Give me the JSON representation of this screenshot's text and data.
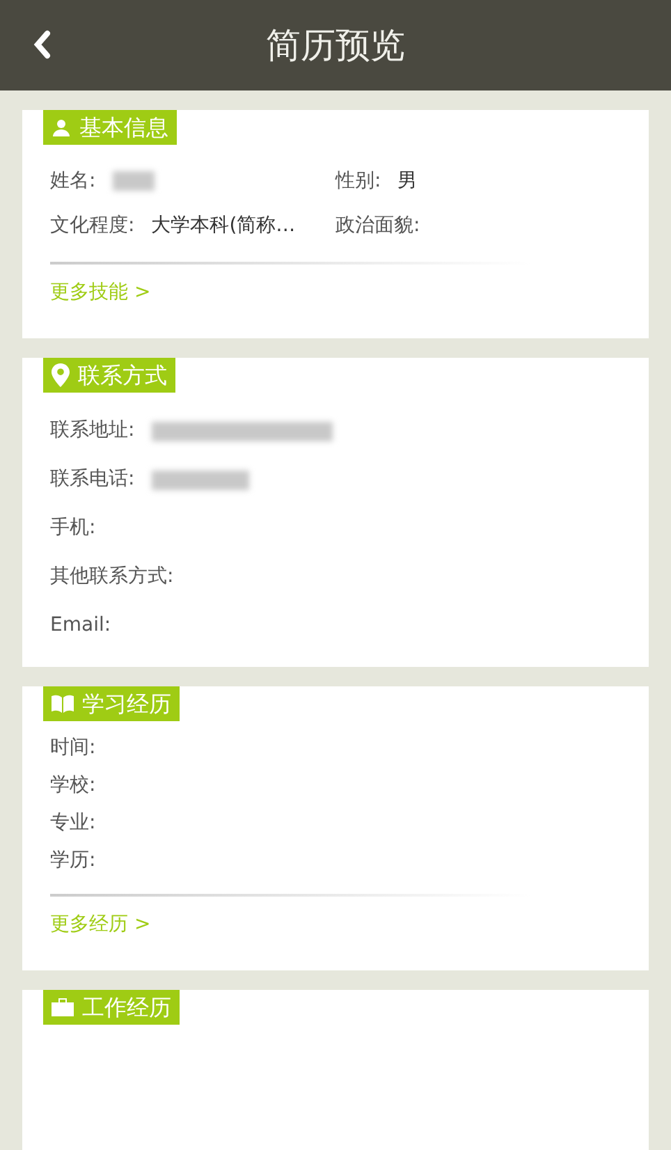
{
  "header": {
    "title": "简历预览"
  },
  "sections": [
    {
      "kind": "grid",
      "title": "基本信息",
      "rows": [
        {
          "label": "姓名:",
          "blurred": true
        },
        {
          "label": "性别:",
          "value": "男",
          "blurred": false
        },
        {
          "label": "文化程度:",
          "value": "大学本科(简称…",
          "blurred": false
        },
        {
          "label": "政治面貌:",
          "blurred": false
        }
      ],
      "more": "更多技能 >"
    },
    {
      "kind": "list",
      "title": "联系方式",
      "rows": [
        {
          "label": "联系地址:",
          "blurred": true
        },
        {
          "label": "联系电话:",
          "blurred": true
        },
        {
          "label": "手机:",
          "blurred": false
        },
        {
          "label": "其他联系方式:",
          "blurred": false
        },
        {
          "label": "Email:",
          "blurred": false
        }
      ]
    },
    {
      "kind": "compact",
      "title": "学习经历",
      "rows": [
        {
          "label": "时间:",
          "blurred": false
        },
        {
          "label": "学校:",
          "blurred": false
        },
        {
          "label": "专业:",
          "blurred": false
        },
        {
          "label": "学历:",
          "blurred": false
        }
      ],
      "more": "更多经历 >"
    },
    {
      "kind": "list",
      "title": "工作经历"
    }
  ]
}
